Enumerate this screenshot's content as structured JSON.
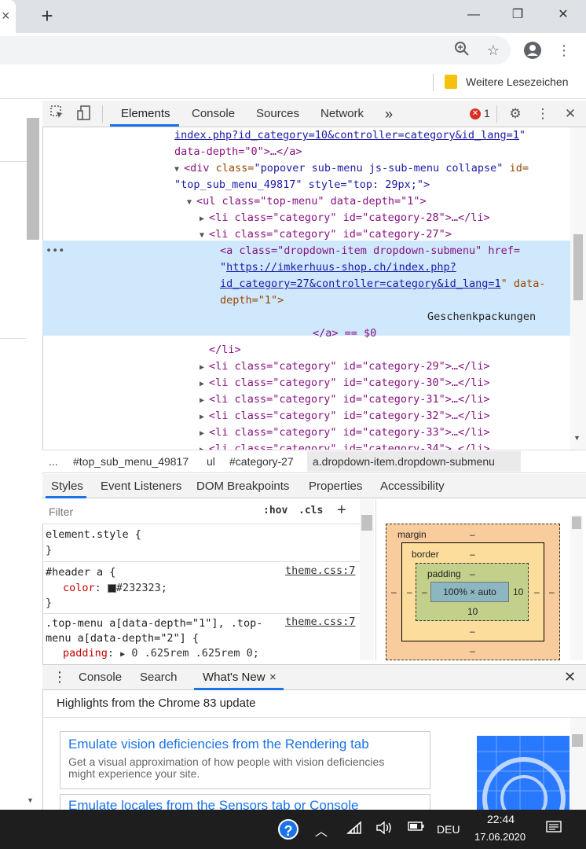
{
  "browser": {
    "new_tab_label": "+",
    "tab_close": "×",
    "window_controls": {
      "minimize": "—",
      "maximize": "❐",
      "close": "✕"
    },
    "toolbar_icons": [
      "zoom-icon",
      "star-icon",
      "profile-icon",
      "menu-icon"
    ],
    "bookmark_label": "Weitere Lesezeichen"
  },
  "devtools": {
    "tabs": [
      "Elements",
      "Console",
      "Sources",
      "Network"
    ],
    "more_tabs": "»",
    "error_count": "1",
    "error_glyph": "✕",
    "tree": {
      "l1_link": "index.php?id_category=10&controller=category&id_lang=1",
      "l1_tail": "\"",
      "l2": "data-depth=\"0\">…</a>",
      "l3_tag": "<div",
      "l3_attr": "class=",
      "l3_val": "\"popover sub-menu js-sub-menu collapse\"",
      "l3_attr2": "id=",
      "l4": "\"top_sub_menu_49817\" style=\"top: 29px;\">",
      "l5": "<ul class=\"top-menu\" data-depth=\"1\">",
      "l6": "<li class=\"category\" id=\"category-28\">…</li>",
      "l7": "<li class=\"category\" id=\"category-27\">",
      "l8": "<a class=\"dropdown-item dropdown-submenu\" href=",
      "l9_link": "https://imkerhuus-shop.ch/index.php?",
      "l10_link": "id_category=27&controller=category&id_lang=1",
      "l10_tail": "\" data-",
      "l11": "depth=\"1\">",
      "l12_text": "Geschenkpackungen",
      "l13": "</a> == $0",
      "l14": "</li>",
      "items": [
        "<li class=\"category\" id=\"category-29\">…</li>",
        "<li class=\"category\" id=\"category-30\">…</li>",
        "<li class=\"category\" id=\"category-31\">…</li>",
        "<li class=\"category\" id=\"category-32\">…</li>",
        "<li class=\"category\" id=\"category-33\">…</li>",
        "<li class=\"category\" id=\"category-34\">…</li>"
      ],
      "dots": "•••"
    },
    "breadcrumbs": [
      "...",
      "#top_sub_menu_49817",
      "ul",
      "#category-27",
      "a.dropdown-item.dropdown-submenu"
    ],
    "style_tabs": [
      "Styles",
      "Event Listeners",
      "DOM Breakpoints",
      "Properties",
      "Accessibility"
    ],
    "filter_placeholder": "Filter",
    "hov": ":hov",
    "cls": ".cls",
    "add": "+",
    "css": {
      "r1_sel": "element.style {",
      "r1_close": "}",
      "r2_sel": "#header a {",
      "r2_src": "theme.css:7",
      "r2_prop": "color",
      "r2_val": "#232323;",
      "r2_close": "}",
      "r3_sel1": ".top-menu a[data-depth=\"1\"], .top-",
      "r3_sel2": "menu a[data-depth=\"2\"] {",
      "r3_src": "theme.css:7",
      "r3_prop": "padding",
      "r3_val": "0 .625rem .625rem 0;"
    },
    "box_model": {
      "margin_label": "margin",
      "margin_val": "–",
      "border_label": "border",
      "border_val": "–",
      "padding_label": "padding",
      "padding_val": "–",
      "content": "100% × auto",
      "padding_right": "10",
      "padding_bottom": "10",
      "dash": "–"
    },
    "drawer": {
      "tabs": [
        "Console",
        "Search",
        "What's New"
      ],
      "close_tab": "×",
      "highlights": "Highlights from the Chrome 83 update",
      "card1_title": "Emulate vision deficiencies from the Rendering tab",
      "card1_desc": "Get a visual approximation of how people with vision deficiencies might experience your site.",
      "card2_title": "Emulate locales from the Sensors tab or Console"
    }
  },
  "taskbar": {
    "lang": "DEU",
    "time": "22:44",
    "date": "17.06.2020",
    "help": "?"
  }
}
